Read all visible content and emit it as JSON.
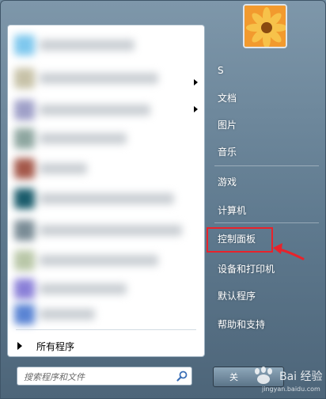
{
  "right_panel": {
    "items": [
      {
        "label": "S"
      },
      {
        "label": "文档"
      },
      {
        "label": "图片"
      },
      {
        "label": "音乐"
      },
      {
        "label": "游戏"
      },
      {
        "label": "计算机"
      },
      {
        "label": "控制面板"
      },
      {
        "label": "设备和打印机"
      },
      {
        "label": "默认程序"
      },
      {
        "label": "帮助和支持"
      }
    ]
  },
  "left_panel": {
    "all_programs_label": "所有程序"
  },
  "search": {
    "placeholder": "搜索程序和文件"
  },
  "shutdown": {
    "label": "关"
  },
  "watermark": {
    "text": "Bai 经验",
    "sub": "jingyan.baidu.com"
  },
  "colors": {
    "highlight": "#e8232b",
    "menu_bg": "#6f8a9e"
  },
  "icons": [
    "search-icon",
    "user-avatar-flower",
    "submenu-arrow-icon",
    "red-arrow-icon",
    "all-programs-arrow-icon"
  ]
}
